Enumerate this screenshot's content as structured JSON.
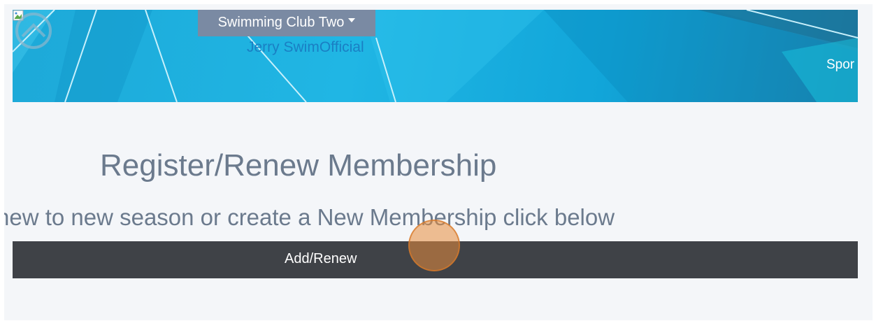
{
  "header": {
    "club_selector": "Swimming Club Two",
    "user_name": "Jerry SwimOfficial",
    "sport_partial": "Spor"
  },
  "main": {
    "title": "Register/Renew Membership",
    "instruction": "new to new season or create a New Membership click below",
    "add_renew_label": "Add/Renew"
  },
  "colors": {
    "hero_blue": "#1da9d8",
    "button_dark": "#3f4247",
    "title_text": "#6b7a8d",
    "link_blue": "#1a7fc4",
    "cursor_highlight": "#e88c3c"
  },
  "icons": {
    "club_caret": "chevron-down-icon",
    "broken_image": "broken-image-icon",
    "emblem": "club-emblem-icon"
  }
}
